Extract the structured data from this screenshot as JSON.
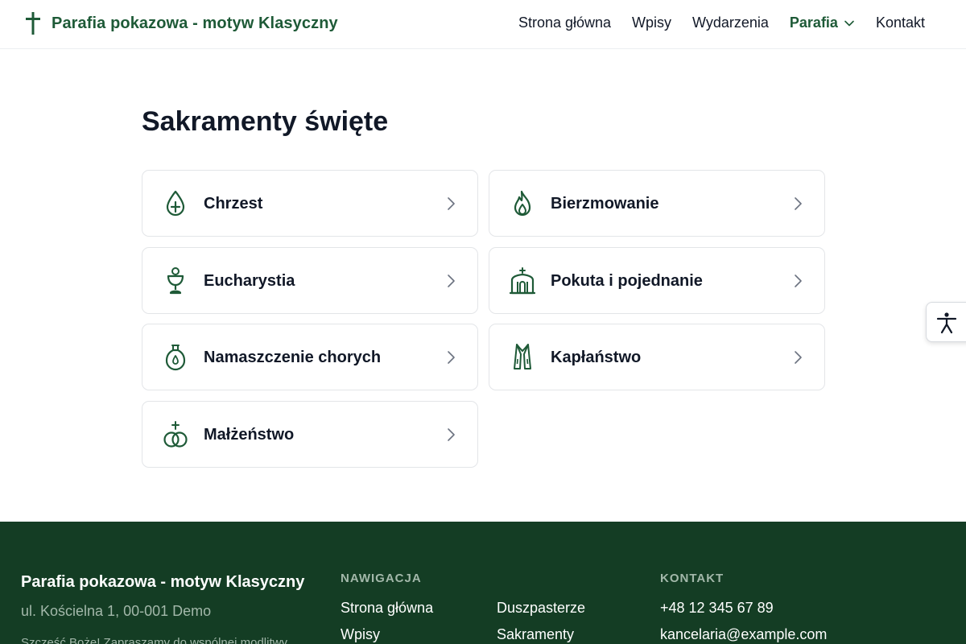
{
  "header": {
    "brand_icon": "cross-icon",
    "brand_title": "Parafia pokazowa - motyw Klasyczny",
    "accent_color": "#1e5a37",
    "nav": [
      {
        "label": "Strona główna"
      },
      {
        "label": "Wpisy"
      },
      {
        "label": "Wydarzenia"
      },
      {
        "label": "Parafia",
        "active": true,
        "has_dropdown": true
      },
      {
        "label": "Kontakt"
      }
    ]
  },
  "main": {
    "title": "Sakramenty święte",
    "cards": [
      {
        "label": "Chrzest",
        "icon": "water-drop-cross-icon"
      },
      {
        "label": "Bierzmowanie",
        "icon": "flame-icon"
      },
      {
        "label": "Eucharystia",
        "icon": "chalice-icon"
      },
      {
        "label": "Pokuta i pojednanie",
        "icon": "confessional-icon"
      },
      {
        "label": "Namaszczenie chorych",
        "icon": "oil-vessel-icon"
      },
      {
        "label": "Kapłaństwo",
        "icon": "stole-icon"
      },
      {
        "label": "Małżeństwo",
        "icon": "wedding-rings-icon"
      }
    ]
  },
  "accessibility": {
    "icon": "accessibility-icon"
  },
  "footer": {
    "background_color": "#143d24",
    "title": "Parafia pokazowa - motyw Klasyczny",
    "address": "ul. Kościelna 1, 00-001 Demo",
    "blurb": "Szczęść Boże! Zapraszamy do wspólnej modlitwy.",
    "nav_heading": "NAWIGACJA",
    "nav_col1": [
      "Strona główna",
      "Wpisy"
    ],
    "nav_col2": [
      "Duszpasterze",
      "Sakramenty"
    ],
    "contact_heading": "KONTAKT",
    "contact": [
      "+48 12 345 67 89",
      "kancelaria@example.com"
    ]
  }
}
